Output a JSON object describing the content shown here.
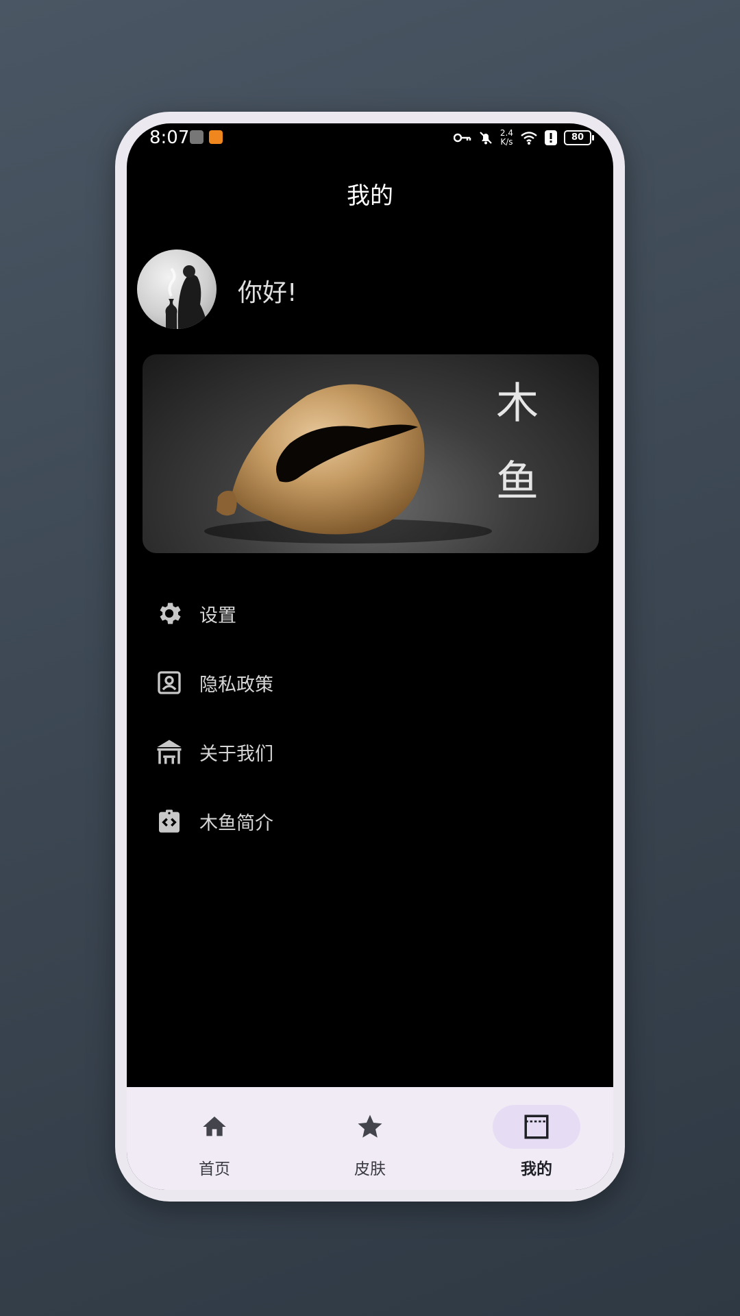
{
  "status_bar": {
    "time": "8:07",
    "net_speed_value": "2.4",
    "net_speed_unit": "K/s",
    "battery": "80",
    "icons": [
      "hd-icon",
      "app-notification-icon",
      "key-icon",
      "bell-off-icon",
      "wifi-icon",
      "alert-icon",
      "battery-icon"
    ]
  },
  "header": {
    "title": "我的"
  },
  "profile": {
    "greeting": "你好!"
  },
  "banner": {
    "title_chars": "木 鱼"
  },
  "menu": {
    "items": [
      {
        "label": "设置",
        "icon": "gear-icon"
      },
      {
        "label": "隐私政策",
        "icon": "account-box-icon"
      },
      {
        "label": "关于我们",
        "icon": "pavilion-icon"
      },
      {
        "label": "木鱼简介",
        "icon": "code-clipboard-icon"
      }
    ]
  },
  "bottom_nav": {
    "items": [
      {
        "label": "首页",
        "icon": "home-icon",
        "active": false
      },
      {
        "label": "皮肤",
        "icon": "star-icon",
        "active": false
      },
      {
        "label": "我的",
        "icon": "window-icon",
        "active": true
      }
    ]
  },
  "colors": {
    "screen_bg": "#000000",
    "nav_bg": "#f1ebf6",
    "nav_active_pill": "#e6ddf5",
    "menu_icon": "#c8c8c8",
    "banner_wood": "#c49a62"
  }
}
